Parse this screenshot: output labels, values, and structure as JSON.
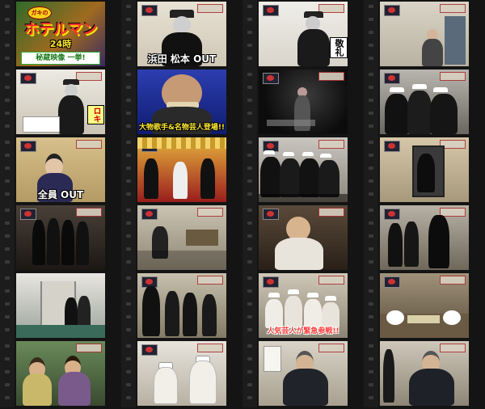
{
  "title_card": {
    "top_badge": "ガキの",
    "main_title": "ホテルマン",
    "sub_title": "24時",
    "bottom_banner": "秘蔵映像 一挙!"
  },
  "frames": [
    {
      "id": 1,
      "caption": "",
      "caption_color": "",
      "label": ""
    },
    {
      "id": 2,
      "caption": "浜田 松本 OUT",
      "caption_color": "white",
      "label": ""
    },
    {
      "id": 3,
      "caption": "",
      "caption_color": "",
      "label": "敬礼"
    },
    {
      "id": 4,
      "caption": "",
      "caption_color": "",
      "label": ""
    },
    {
      "id": 5,
      "caption": "",
      "caption_color": "",
      "label": "ロキ"
    },
    {
      "id": 6,
      "caption": "大物歌手&名物芸人登場!!",
      "caption_color": "yellow",
      "label": ""
    },
    {
      "id": 7,
      "caption": "",
      "caption_color": "",
      "label": ""
    },
    {
      "id": 8,
      "caption": "",
      "caption_color": "",
      "label": ""
    },
    {
      "id": 9,
      "caption": "全員 OUT",
      "caption_color": "white",
      "label": ""
    },
    {
      "id": 10,
      "caption": "",
      "caption_color": "",
      "label": ""
    },
    {
      "id": 11,
      "caption": "",
      "caption_color": "",
      "label": ""
    },
    {
      "id": 12,
      "caption": "",
      "caption_color": "",
      "label": ""
    },
    {
      "id": 13,
      "caption": "",
      "caption_color": "",
      "label": ""
    },
    {
      "id": 14,
      "caption": "",
      "caption_color": "",
      "label": ""
    },
    {
      "id": 15,
      "caption": "",
      "caption_color": "",
      "label": ""
    },
    {
      "id": 16,
      "caption": "",
      "caption_color": "",
      "label": ""
    },
    {
      "id": 17,
      "caption": "",
      "caption_color": "",
      "label": ""
    },
    {
      "id": 18,
      "caption": "",
      "caption_color": "",
      "label": ""
    },
    {
      "id": 19,
      "caption": "人気芸人が緊急参戦!!",
      "caption_color": "red",
      "label": ""
    },
    {
      "id": 20,
      "caption": "",
      "caption_color": "",
      "label": ""
    },
    {
      "id": 21,
      "caption": "",
      "caption_color": "",
      "label": ""
    },
    {
      "id": 22,
      "caption": "",
      "caption_color": "",
      "label": ""
    },
    {
      "id": 23,
      "caption": "",
      "caption_color": "",
      "label": ""
    },
    {
      "id": 24,
      "caption": "",
      "caption_color": "",
      "label": ""
    }
  ],
  "colors": {
    "background": "#141414",
    "film_strip": "#1c1c1c",
    "caption_white": "#ffffff",
    "caption_yellow": "#ffe930",
    "caption_red": "#ff3a3a"
  }
}
